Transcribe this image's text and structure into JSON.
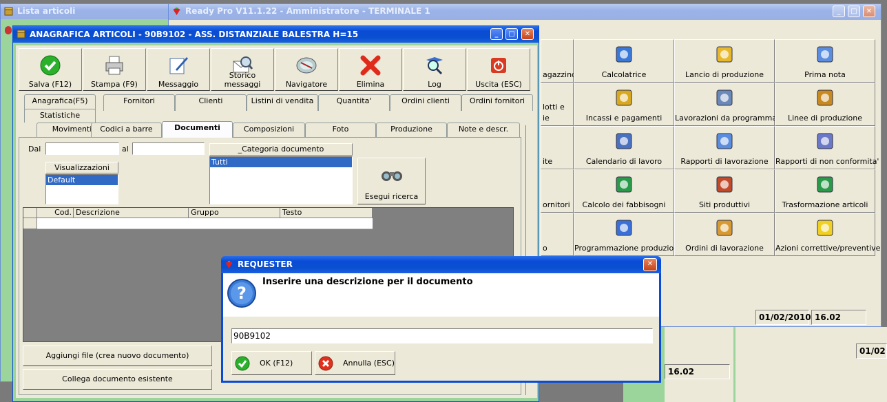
{
  "windows": {
    "lista": {
      "title": "Lista articoli"
    },
    "ready": {
      "title": "Ready Pro V11.1.22 - Amministratore - TERMINALE 1"
    },
    "anagrafica": {
      "title": "ANAGRAFICA ARTICOLI - 90B9102 - ASS. DISTANZIALE BALESTRA H=15"
    },
    "requester": {
      "title": "REQUESTER"
    }
  },
  "toolbar": {
    "salva": "Salva (F12)",
    "stampa": "Stampa (F9)",
    "messaggio": "Messaggio",
    "storico": "Storico messaggi",
    "navigatore": "Navigatore",
    "elimina": "Elimina",
    "log": "Log",
    "uscita": "Uscita (ESC)"
  },
  "tabs_row1": [
    "Anagrafica(F5)",
    "Fornitori",
    "Clienti",
    "Listini di vendita",
    "Quantita'",
    "Ordini clienti",
    "Ordini fornitori"
  ],
  "tabs_row1b": [
    "Statistiche"
  ],
  "tabs_row2": [
    "Movimenti",
    "Codici a barre",
    "Documenti",
    "Composizioni",
    "Foto",
    "Produzione",
    "Note e descr."
  ],
  "filters": {
    "dal_label": "Dal",
    "al_label": "al",
    "categoria_header": "_Categoria documento",
    "categoria_selected": "Tutti",
    "visualizzazioni_header": "Visualizzazioni",
    "visualizzazioni_selected": "Default",
    "esegui": "Esegui ricerca"
  },
  "grid": {
    "columns": [
      "Cod.",
      "Descrizione",
      "Gruppo",
      "Testo"
    ]
  },
  "bottom_buttons": {
    "aggiungi": "Aggiungi file (crea nuovo documento)",
    "collega": "Collega documento esistente"
  },
  "menu_tiles": [
    [
      "agazzino",
      "Calcolatrice",
      "Lancio di produzione",
      "Prima nota"
    ],
    [
      "lotti e",
      "Incassi e pagamenti",
      "Lavorazioni da programmare",
      "Linee di produzione"
    ],
    [
      "ite",
      "Calendario di lavoro",
      "Rapporti di lavorazione",
      "Rapporti di non conformita'"
    ],
    [
      "ornitori",
      "Calcolo dei fabbisogni",
      "Siti produttivi",
      "Trasformazione articoli"
    ],
    [
      "o",
      "Programmazione produzione",
      "Ordini di lavorazione",
      "Azioni correttive/preventive"
    ]
  ],
  "menu_tile_extra": "ie",
  "status_bar": {
    "date": "01/02/2010",
    "time": "16.02"
  },
  "status_bar2": {
    "time": "16.02",
    "date": "01/02"
  },
  "requester": {
    "message": "Inserire una descrizione per il documento",
    "input_value": "90B9102",
    "ok": "OK (F12)",
    "annulla": "Annulla (ESC)"
  },
  "colors": {
    "xp_blue": "#0a4bd6",
    "face": "#ece9d8",
    "selection": "#316ac5",
    "desktop": "#7a7a7a"
  }
}
